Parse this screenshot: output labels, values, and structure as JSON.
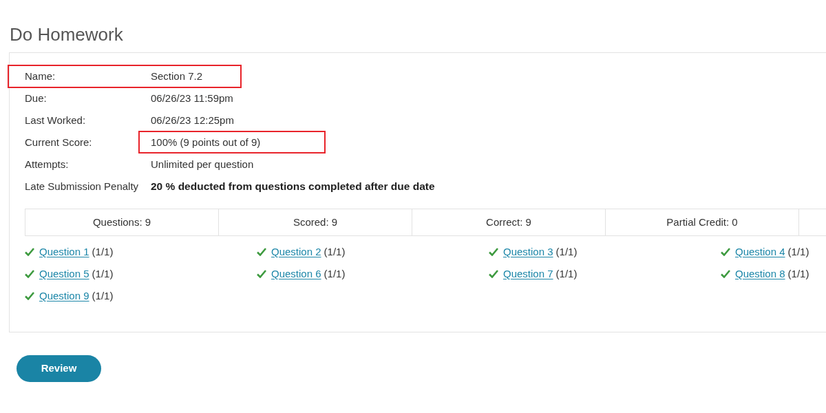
{
  "page": {
    "title": "Do Homework"
  },
  "details": [
    {
      "label": "Name:",
      "value": "Section 7.2",
      "row_highlighted": true,
      "bold": false
    },
    {
      "label": "Due:",
      "value": "06/26/23 11:59pm",
      "bold": false
    },
    {
      "label": "Last Worked:",
      "value": "06/26/23 12:25pm",
      "bold": false
    },
    {
      "label": "Current Score:",
      "value": "100% (9 points out of 9)",
      "value_highlighted": true,
      "bold": false
    },
    {
      "label": "Attempts:",
      "value": "Unlimited per question",
      "bold": false
    },
    {
      "label": "Late Submission Penalty",
      "value": "20 % deducted from questions completed after due date",
      "bold": true
    }
  ],
  "summary": [
    "Questions: 9",
    "Scored: 9",
    "Correct: 9",
    "Partial Credit: 0"
  ],
  "questions": [
    {
      "label": "Question 1",
      "score": "(1/1)",
      "correct": true
    },
    {
      "label": "Question 2",
      "score": "(1/1)",
      "correct": true
    },
    {
      "label": "Question 3",
      "score": "(1/1)",
      "correct": true
    },
    {
      "label": "Question 4",
      "score": "(1/1)",
      "correct": true
    },
    {
      "label": "Question 5",
      "score": "(1/1)",
      "correct": true
    },
    {
      "label": "Question 6",
      "score": "(1/1)",
      "correct": true
    },
    {
      "label": "Question 7",
      "score": "(1/1)",
      "correct": true
    },
    {
      "label": "Question 8",
      "score": "(1/1)",
      "correct": true
    },
    {
      "label": "Question 9",
      "score": "(1/1)",
      "correct": true
    }
  ],
  "buttons": [
    {
      "label": "Review"
    }
  ]
}
